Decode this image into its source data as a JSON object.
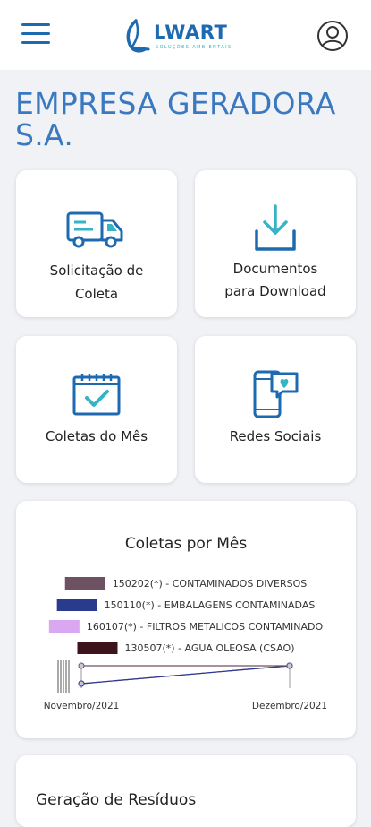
{
  "header": {
    "logo_word": "LWART",
    "logo_tagline": "SOLUÇÕES AMBIENTAIS"
  },
  "company_name": "EMPRESA GERADORA S.A.",
  "tiles": [
    {
      "label_line1": "Solicitação de",
      "label_line2": "Coleta",
      "icon": "truck-icon"
    },
    {
      "label_line1": "Documentos",
      "label_line2": "para Download",
      "icon": "download-icon"
    },
    {
      "label": "Coletas do Mês",
      "icon": "calendar-check-icon"
    },
    {
      "label": "Redes Sociais",
      "icon": "smartphone-chat-icon"
    }
  ],
  "chart_card": {
    "title": "Coletas por Mês"
  },
  "chart_data": {
    "type": "line",
    "title": "Coletas por Mês",
    "categories": [
      "Novembro/2021",
      "Dezembro/2021"
    ],
    "series": [
      {
        "name": "150202(*) - CONTAMINADOS DIVERSOS",
        "color": "#6e5264",
        "values": [
          10,
          10
        ]
      },
      {
        "name": "150110(*) - EMBALAGENS CONTAMINADAS",
        "color": "#2a3a8c",
        "values": [
          2,
          10
        ]
      },
      {
        "name": "160107(*) - FILTROS METALICOS CONTAMINADO",
        "color": "#d9a8f0",
        "values": [
          2,
          10
        ]
      },
      {
        "name": "130507(*) - AGUA OLEOSA (CSAO)",
        "color": "#3e141c",
        "values": [
          2,
          10
        ]
      }
    ]
  },
  "second_card": {
    "title": "Geração de Resíduos"
  }
}
